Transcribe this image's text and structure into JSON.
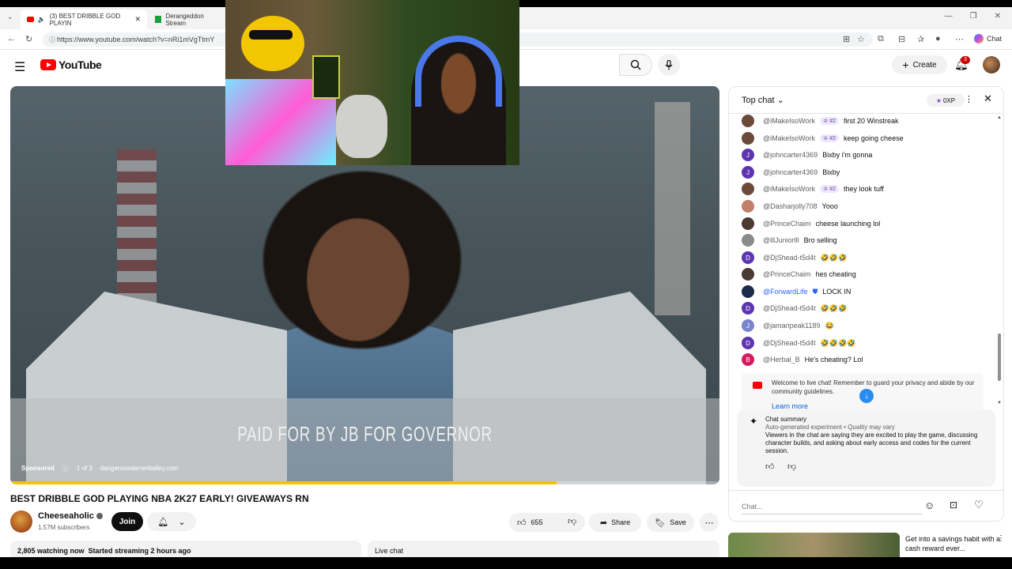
{
  "browser": {
    "tabs": [
      {
        "label": "(3) BEST DRIBBLE GOD PLAYIN"
      },
      {
        "label": "Derangeddon Stream"
      }
    ],
    "url": "https://www.youtube.com/watch?v=nRi1mVgTtmY",
    "chat_label": "Chat"
  },
  "header": {
    "logo_text": "YouTube",
    "create_label": "Create",
    "notification_count": "3"
  },
  "video": {
    "overlay_text": "PAID FOR BY JB FOR GOVERNOR",
    "sponsored_label": "Sponsored",
    "ad_position": "1 of 3",
    "ad_domain": "dangerousdarrenbailey.com",
    "progress": 0.77
  },
  "info": {
    "title": "BEST DRIBBLE GOD PLAYING NBA 2K27 EARLY! GIVEAWAYS RN",
    "channel_name": "Cheeseaholic",
    "subscribers": "1.57M subscribers",
    "join_label": "Join",
    "likes": "655",
    "share_label": "Share",
    "save_label": "Save",
    "watching": "2,805 watching now  Started streaming 2 hours ago",
    "live_chat_label": "Live chat"
  },
  "chat": {
    "mode_label": "Top chat",
    "xp_label": "0XP",
    "messages": [
      {
        "author": "@iMakeIsoWork",
        "badge": "#2",
        "text": "first 20 Winstreak",
        "avatar_color": "#6b4a3a",
        "initial": ""
      },
      {
        "author": "@iMakeIsoWork",
        "badge": "#2",
        "text": "keep going cheese",
        "avatar_color": "#6b4a3a",
        "initial": ""
      },
      {
        "author": "@johncarter4369",
        "badge": "",
        "text": "Bixby i'm gonna",
        "avatar_color": "#5e35b1",
        "initial": "J"
      },
      {
        "author": "@johncarter4369",
        "badge": "",
        "text": "Bixby",
        "avatar_color": "#5e35b1",
        "initial": "J"
      },
      {
        "author": "@iMakeIsoWork",
        "badge": "#2",
        "text": "they look tuff",
        "avatar_color": "#6b4a3a",
        "initial": ""
      },
      {
        "author": "@Dasharjolly708",
        "badge": "",
        "text": "Yooo",
        "avatar_color": "#c0806a",
        "initial": ""
      },
      {
        "author": "@PrinceChaim",
        "badge": "",
        "text": "cheese launching lol",
        "avatar_color": "#4a3a32",
        "initial": ""
      },
      {
        "author": "@lllJuniorlll",
        "badge": "",
        "text": "Bro selling",
        "avatar_color": "#8a8a8a",
        "initial": ""
      },
      {
        "author": "@DjShead-t5d4t",
        "badge": "",
        "text": "🤣🤣🤣",
        "avatar_color": "#5e35b1",
        "initial": "D"
      },
      {
        "author": "@PrinceChaim",
        "badge": "",
        "text": "hes cheating",
        "avatar_color": "#4a3a32",
        "initial": ""
      },
      {
        "author": "@ForwardLife",
        "badge": "",
        "text": "LOCK IN",
        "avatar_color": "#1d2a4a",
        "initial": "",
        "moderator": true
      },
      {
        "author": "@DjShead-t5d4t",
        "badge": "",
        "text": "🤣🤣🤣",
        "avatar_color": "#5e35b1",
        "initial": "D"
      },
      {
        "author": "@jamaripeak1189",
        "badge": "",
        "text": "😂",
        "avatar_color": "#7986cb",
        "initial": "J"
      },
      {
        "author": "@DjShead-t5d4t",
        "badge": "",
        "text": "🤣🤣🤣🤣",
        "avatar_color": "#5e35b1",
        "initial": "D"
      },
      {
        "author": "@Herbal_B",
        "badge": "",
        "text": "He's cheating? Lol",
        "avatar_color": "#d81b60",
        "initial": "B"
      }
    ],
    "welcome_text": "Welcome to live chat! Remember to guard your privacy and abide by our community guidelines.",
    "learn_more": "Learn more",
    "summary_title": "Chat summary",
    "summary_subtitle": "Auto-generated experiment • Quality may vary",
    "summary_body": "Viewers in the chat are saying they are excited to play the game, discussing character builds, and asking about early access and codes for the current session.",
    "input_placeholder": "Chat..."
  },
  "side_ad": {
    "title": "Get into a savings habit with a cash reward ever..."
  }
}
